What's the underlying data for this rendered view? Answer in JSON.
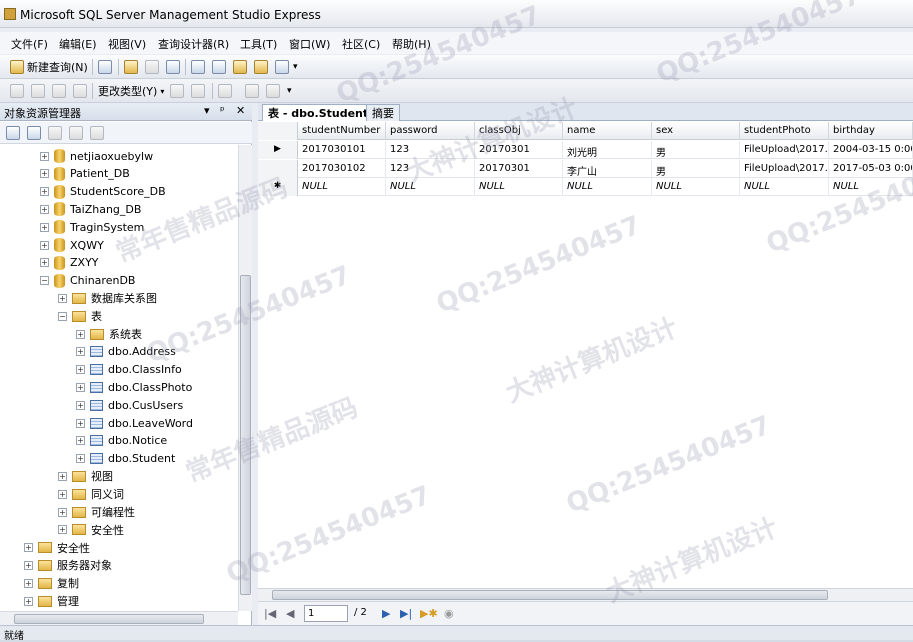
{
  "window": {
    "title": "Microsoft SQL Server Management Studio Express"
  },
  "menu": [
    "文件(F)",
    "编辑(E)",
    "视图(V)",
    "查询设计器(R)",
    "工具(T)",
    "窗口(W)",
    "社区(C)",
    "帮助(H)"
  ],
  "toolbar": {
    "new_query": "新建查询(N)",
    "change_type": "更改类型(Y)"
  },
  "object_explorer": {
    "title": "对象资源管理器",
    "pin": "ᵖ",
    "close": "✕",
    "nodes": [
      {
        "label": "netjiaoxuebylw",
        "type": "db",
        "level": 0,
        "exp": "+"
      },
      {
        "label": "Patient_DB",
        "type": "db",
        "level": 0,
        "exp": "+"
      },
      {
        "label": "StudentScore_DB",
        "type": "db",
        "level": 0,
        "exp": "+"
      },
      {
        "label": "TaiZhang_DB",
        "type": "db",
        "level": 0,
        "exp": "+"
      },
      {
        "label": "TraginSystem",
        "type": "db",
        "level": 0,
        "exp": "+"
      },
      {
        "label": "XQWY",
        "type": "db",
        "level": 0,
        "exp": "+"
      },
      {
        "label": "ZXYY",
        "type": "db",
        "level": 0,
        "exp": "+"
      },
      {
        "label": "ChinarenDB",
        "type": "db",
        "level": 0,
        "exp": "−"
      },
      {
        "label": "数据库关系图",
        "type": "folder",
        "level": 1,
        "exp": "+"
      },
      {
        "label": "表",
        "type": "folder",
        "level": 1,
        "exp": "−"
      },
      {
        "label": "系统表",
        "type": "folder",
        "level": 2,
        "exp": "+"
      },
      {
        "label": "dbo.Address",
        "type": "table",
        "level": 2,
        "exp": "+"
      },
      {
        "label": "dbo.ClassInfo",
        "type": "table",
        "level": 2,
        "exp": "+"
      },
      {
        "label": "dbo.ClassPhoto",
        "type": "table",
        "level": 2,
        "exp": "+"
      },
      {
        "label": "dbo.CusUsers",
        "type": "table",
        "level": 2,
        "exp": "+"
      },
      {
        "label": "dbo.LeaveWord",
        "type": "table",
        "level": 2,
        "exp": "+"
      },
      {
        "label": "dbo.Notice",
        "type": "table",
        "level": 2,
        "exp": "+"
      },
      {
        "label": "dbo.Student",
        "type": "table",
        "level": 2,
        "exp": "+"
      },
      {
        "label": "视图",
        "type": "folder",
        "level": 1,
        "exp": "+"
      },
      {
        "label": "同义词",
        "type": "folder",
        "level": 1,
        "exp": "+"
      },
      {
        "label": "可编程性",
        "type": "folder",
        "level": 1,
        "exp": "+"
      },
      {
        "label": "安全性",
        "type": "folder",
        "level": 1,
        "exp": "+"
      },
      {
        "label": "安全性",
        "type": "folder",
        "level": -1,
        "exp": "+"
      },
      {
        "label": "服务器对象",
        "type": "folder",
        "level": -1,
        "exp": "+"
      },
      {
        "label": "复制",
        "type": "folder",
        "level": -1,
        "exp": "+"
      },
      {
        "label": "管理",
        "type": "folder",
        "level": -1,
        "exp": "+"
      }
    ]
  },
  "tabs": [
    {
      "label": "表 - dbo.Student",
      "active": true
    },
    {
      "label": "摘要",
      "active": false
    }
  ],
  "grid": {
    "columns": [
      "studentNumber",
      "password",
      "classObj",
      "name",
      "sex",
      "studentPhoto",
      "birthday"
    ],
    "rows": [
      {
        "marker": "▶",
        "cells": [
          "2017030101",
          "123",
          "20170301",
          "刘光明",
          "男",
          "FileUpload\\2017...",
          "2004-03-15 0:00..."
        ]
      },
      {
        "marker": "",
        "cells": [
          "2017030102",
          "123",
          "20170301",
          "李广山",
          "男",
          "FileUpload\\2017...",
          "2017-05-03 0:00..."
        ]
      },
      {
        "marker": "✱",
        "cells": [
          "NULL",
          "NULL",
          "NULL",
          "NULL",
          "NULL",
          "NULL",
          "NULL"
        ],
        "null": true
      }
    ]
  },
  "navigator": {
    "page": "1",
    "total": "/ 2"
  },
  "status": "就绪",
  "watermarks": [
    "QQ:254540457",
    "大神计算机设计",
    "常年售精品源码"
  ]
}
